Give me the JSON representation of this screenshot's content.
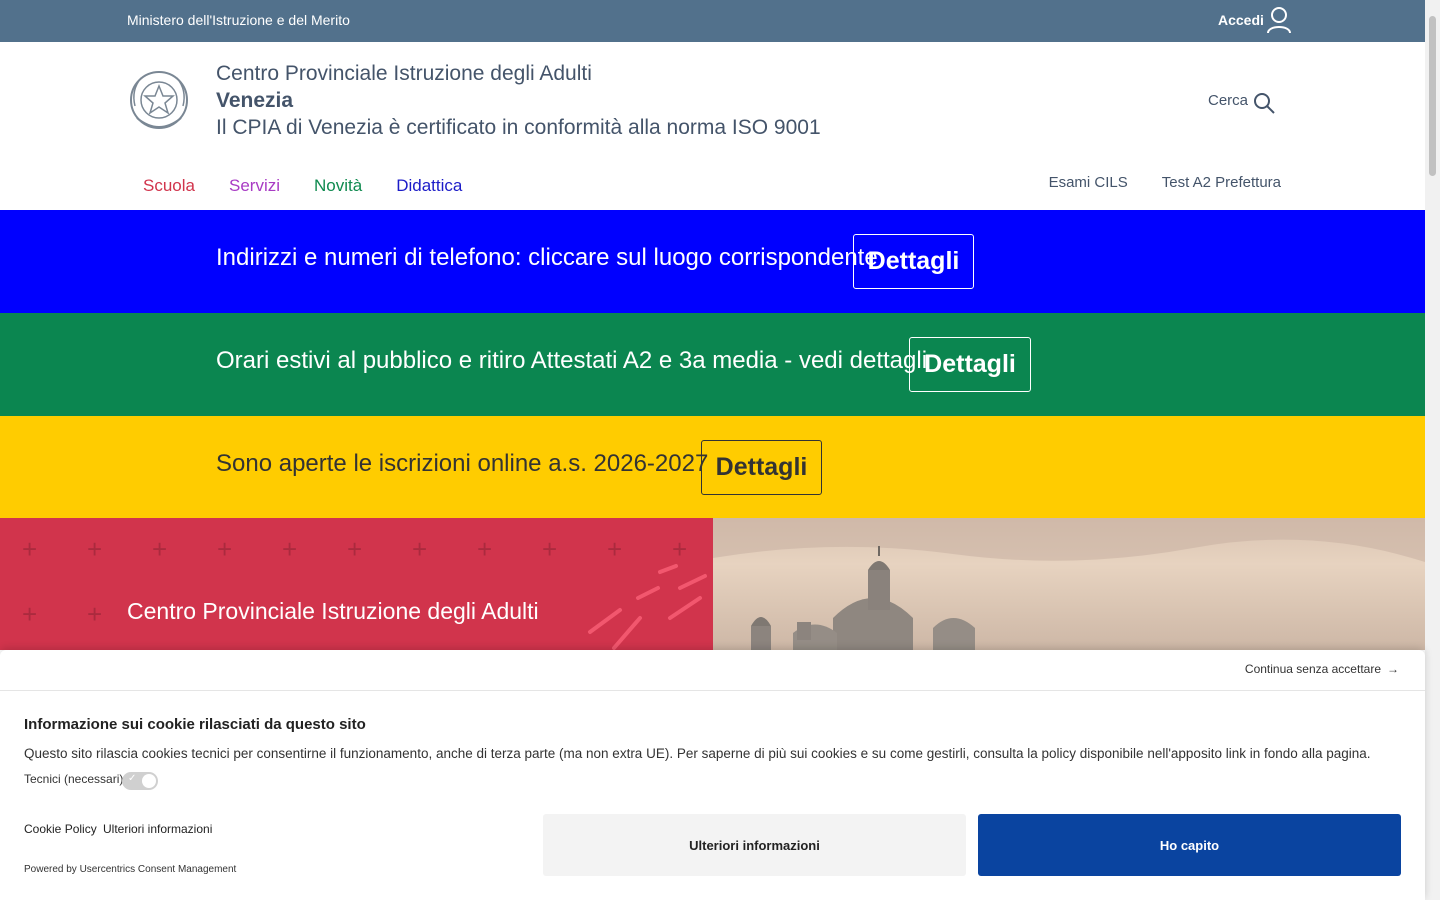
{
  "topbar": {
    "ministry": "Ministero dell'Istruzione e del Merito",
    "login": "Accedi",
    "color": "#52718c"
  },
  "header": {
    "line1": "Centro Provinciale Istruzione degli Adulti",
    "line2": "Venezia",
    "line3": "Il CPIA di Venezia è certificato in conformità alla norma ISO 9001",
    "search": "Cerca"
  },
  "nav": {
    "main": [
      {
        "label": "Scuola",
        "color": "#d1344c"
      },
      {
        "label": "Servizi",
        "color": "#a83bc4"
      },
      {
        "label": "Novità",
        "color": "#0f8a4f"
      },
      {
        "label": "Didattica",
        "color": "#1c1cc8"
      }
    ],
    "secondary": [
      {
        "label": "Esami CILS"
      },
      {
        "label": "Test A2 Prefettura"
      }
    ]
  },
  "banners": [
    {
      "text": "Indirizzi e numeri di telefono: cliccare sul luogo corrispondente",
      "button": "Dettagli",
      "bg": "#0000ff",
      "fg": "#ffffff"
    },
    {
      "text": "Orari estivi al pubblico e ritiro Attestati A2 e 3a media - vedi dettagli",
      "button": "Dettagli",
      "bg": "#0b8650",
      "fg": "#ffffff"
    },
    {
      "text": "Sono aperte le iscrizioni online a.s. 2026-2027",
      "button": "Dettagli",
      "bg": "#ffcc00",
      "fg": "#333333"
    }
  ],
  "hero": {
    "title": "Centro Provinciale Istruzione degli Adulti",
    "color": "#d1344c"
  },
  "cookie": {
    "continue": "Continua senza accettare",
    "title": "Informazione sui cookie rilasciati da questo sito",
    "description": "Questo sito rilascia cookies tecnici per consentirne il funzionamento, anche di terza parte (ma non extra UE). Per saperne di più sui cookies e su come gestirli, consulta la policy disponibile nell'apposito link in fondo alla pagina.",
    "tech_label": "Tecnici (necessari)",
    "link_policy": "Cookie Policy",
    "link_more": "Ulteriori informazioni",
    "powered": "Powered by Usercentrics Consent Management",
    "btn_more": "Ulteriori informazioni",
    "btn_ok": "Ho capito",
    "accent": "#0a44a0"
  }
}
